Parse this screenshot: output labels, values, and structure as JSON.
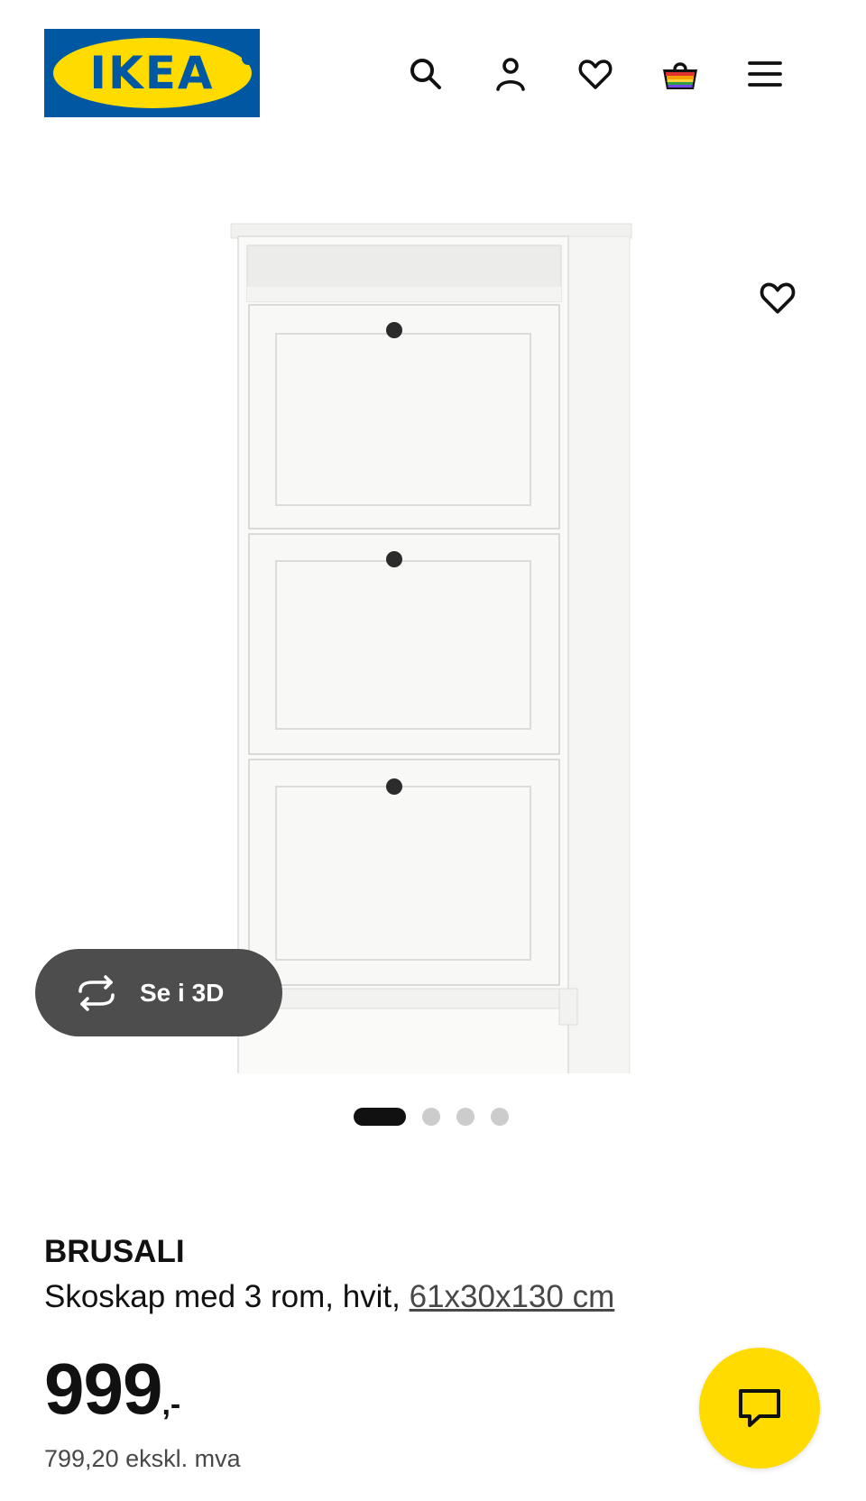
{
  "header": {
    "logo_text": "IKEA",
    "icons": [
      "search-icon",
      "account-icon",
      "favorites-icon",
      "cart-icon",
      "menu-icon"
    ]
  },
  "gallery": {
    "image_subject": "white shoe cabinet with 3 compartments",
    "see_in_3d_label": "Se i 3D",
    "slide_count": 4,
    "active_slide": 1
  },
  "product": {
    "name": "BRUSALI",
    "description_prefix": "Skoskap med 3 rom, hvit, ",
    "dimensions_link": "61x30x130 cm",
    "price_integer": "999",
    "price_suffix": ",-",
    "price_excl_vat": "799,20 ekskl. mva"
  },
  "colors": {
    "brand_blue": "#0058a3",
    "brand_yellow": "#ffdb00",
    "text": "#111111",
    "muted": "#484848",
    "pill_bg": "#4d4d4d"
  }
}
